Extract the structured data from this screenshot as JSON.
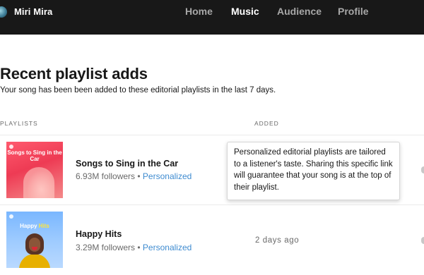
{
  "header": {
    "artist_name": "Miri Mira",
    "nav": [
      "Home",
      "Music",
      "Audience",
      "Profile"
    ],
    "active_nav": "Music"
  },
  "main": {
    "title": "Recent playlist adds",
    "subtitle": "Your song has been been added to these editorial playlists in the last 7 days.",
    "columns": {
      "playlists": "PLAYLISTS",
      "added": "ADDED"
    },
    "rows": [
      {
        "cover_text": "Songs to Sing in the Car",
        "name": "Songs to Sing in the Car",
        "followers": "6.93M followers",
        "separator": " • ",
        "tag": "Personalized",
        "added": ""
      },
      {
        "cover_text_a": "Happy ",
        "cover_text_b": "Hits",
        "name": "Happy Hits",
        "followers": "3.29M followers",
        "separator": " • ",
        "tag": "Personalized",
        "added": "2 days ago"
      }
    ],
    "tooltip": "Personalized editorial playlists are tailored to a listener's taste. Sharing this specific link will guarantee that your song is at the top of their playlist."
  },
  "colors": {
    "topbar": "#181818",
    "link": "#3e8bd0",
    "muted": "#6a6a6a"
  }
}
